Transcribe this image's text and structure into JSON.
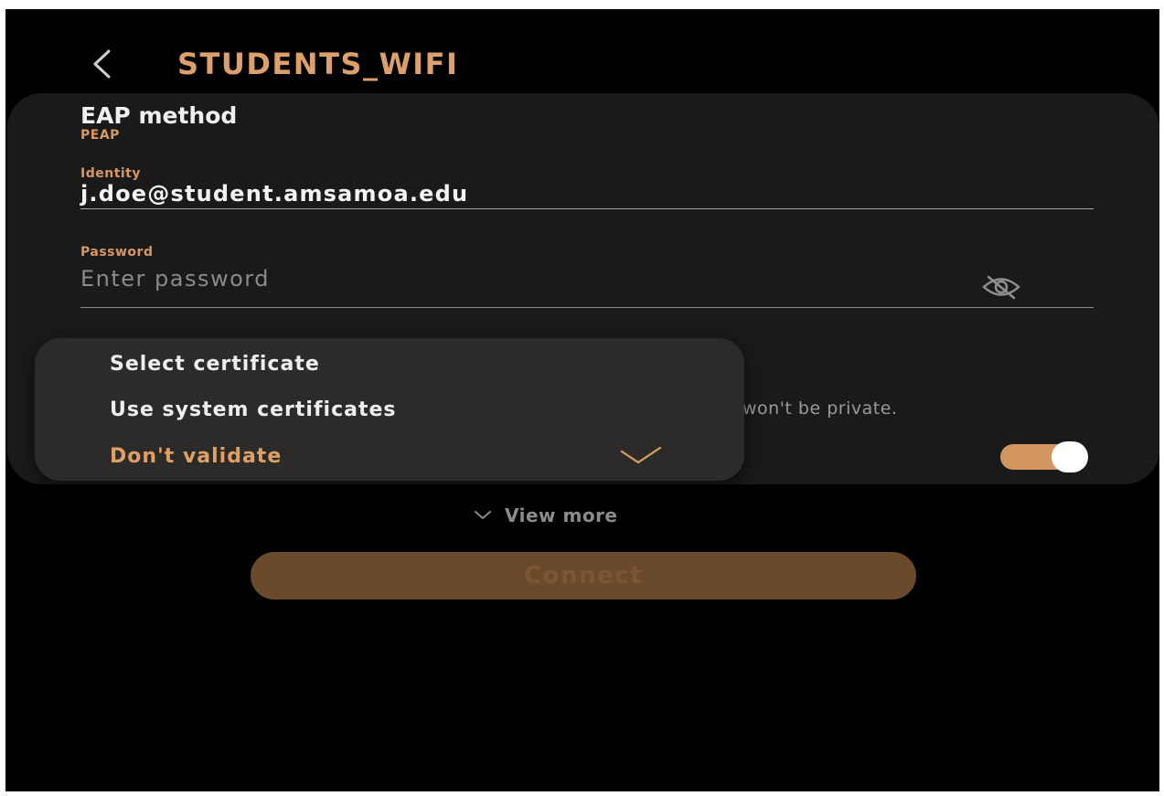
{
  "header": {
    "back_icon": "chevron-left-icon",
    "title": "STUDENTS_WIFI"
  },
  "form": {
    "eap_method": {
      "label": "EAP method",
      "value": "PEAP"
    },
    "identity": {
      "label": "Identity",
      "value": "j.doe@student.amsamoa.edu"
    },
    "password": {
      "label": "Password",
      "placeholder": "Enter password",
      "value": "",
      "visibility_icon": "eye-off-icon"
    },
    "privacy_warning_visible": "won't be private.",
    "toggle": {
      "state": "on",
      "icon": "toggle-switch"
    }
  },
  "certificate_dropdown": {
    "options": [
      {
        "label": "Select certificate",
        "selected": false
      },
      {
        "label": "Use system certificates",
        "selected": false
      },
      {
        "label": "Don't validate",
        "selected": true
      }
    ],
    "selected_icon": "checkmark-icon"
  },
  "view_more": {
    "label": "View more",
    "icon": "chevron-down-icon"
  },
  "connect_button": {
    "label": "Connect",
    "enabled": false
  },
  "colors": {
    "accent": "#d99862",
    "background": "#000000",
    "card": "#1a1a1a",
    "dropdown": "#2c2b29",
    "connect_disabled": "#6b4a2c"
  }
}
